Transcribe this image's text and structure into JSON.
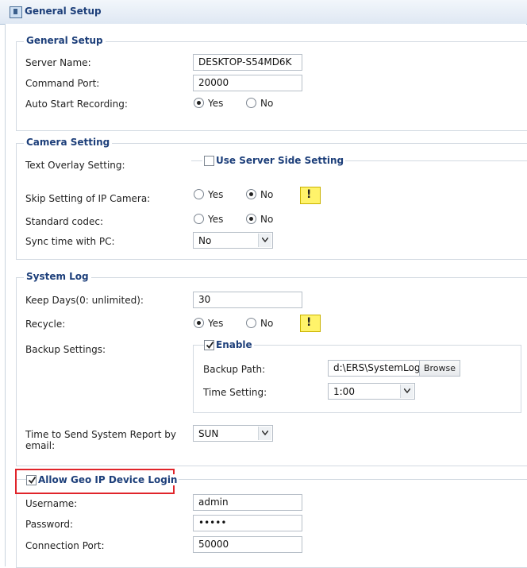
{
  "window": {
    "title": "General Setup"
  },
  "general": {
    "legend": "General Setup",
    "server_name_label": "Server Name:",
    "server_name_value": "DESKTOP-S54MD6K",
    "command_port_label": "Command Port:",
    "command_port_value": "20000",
    "auto_start_label": "Auto Start Recording:",
    "yes": "Yes",
    "no": "No",
    "auto_start_selected": "Yes"
  },
  "camera": {
    "legend": "Camera Setting",
    "text_overlay_label": "Text Overlay Setting:",
    "use_server_side_label": "Use Server Side Setting",
    "use_server_side_checked": false,
    "skip_ip_label": "Skip Setting of IP Camera:",
    "skip_ip_selected": "No",
    "std_codec_label": "Standard codec:",
    "std_codec_selected": "No",
    "sync_time_label": "Sync time with PC:",
    "sync_time_value": "No",
    "yes": "Yes",
    "no": "No",
    "warn_glyph": "!"
  },
  "syslog": {
    "legend": "System Log",
    "keep_days_label": "Keep Days(0: unlimited):",
    "keep_days_value": "30",
    "recycle_label": "Recycle:",
    "recycle_selected": "Yes",
    "yes": "Yes",
    "no": "No",
    "warn_glyph": "!",
    "backup_label": "Backup Settings:",
    "enable_label": "Enable",
    "enable_checked": true,
    "backup_path_label": "Backup Path:",
    "backup_path_value": "d:\\ERS\\SystemLog",
    "browse_label": "Browse",
    "time_setting_label": "Time Setting:",
    "time_setting_value": "1:00",
    "report_label": "Time to Send System Report by email:",
    "report_value": "SUN"
  },
  "geo": {
    "legend": "Allow Geo IP Device Login",
    "checked": true,
    "username_label": "Username:",
    "username_value": "admin",
    "password_label": "Password:",
    "password_value": "•••••",
    "conn_port_label": "Connection Port:",
    "conn_port_value": "50000",
    "highlight_color": "#e0242a"
  },
  "colors": {
    "legend": "#1d3f7a",
    "title_bg": "#dfe8f3",
    "warn": "#fff36a"
  }
}
